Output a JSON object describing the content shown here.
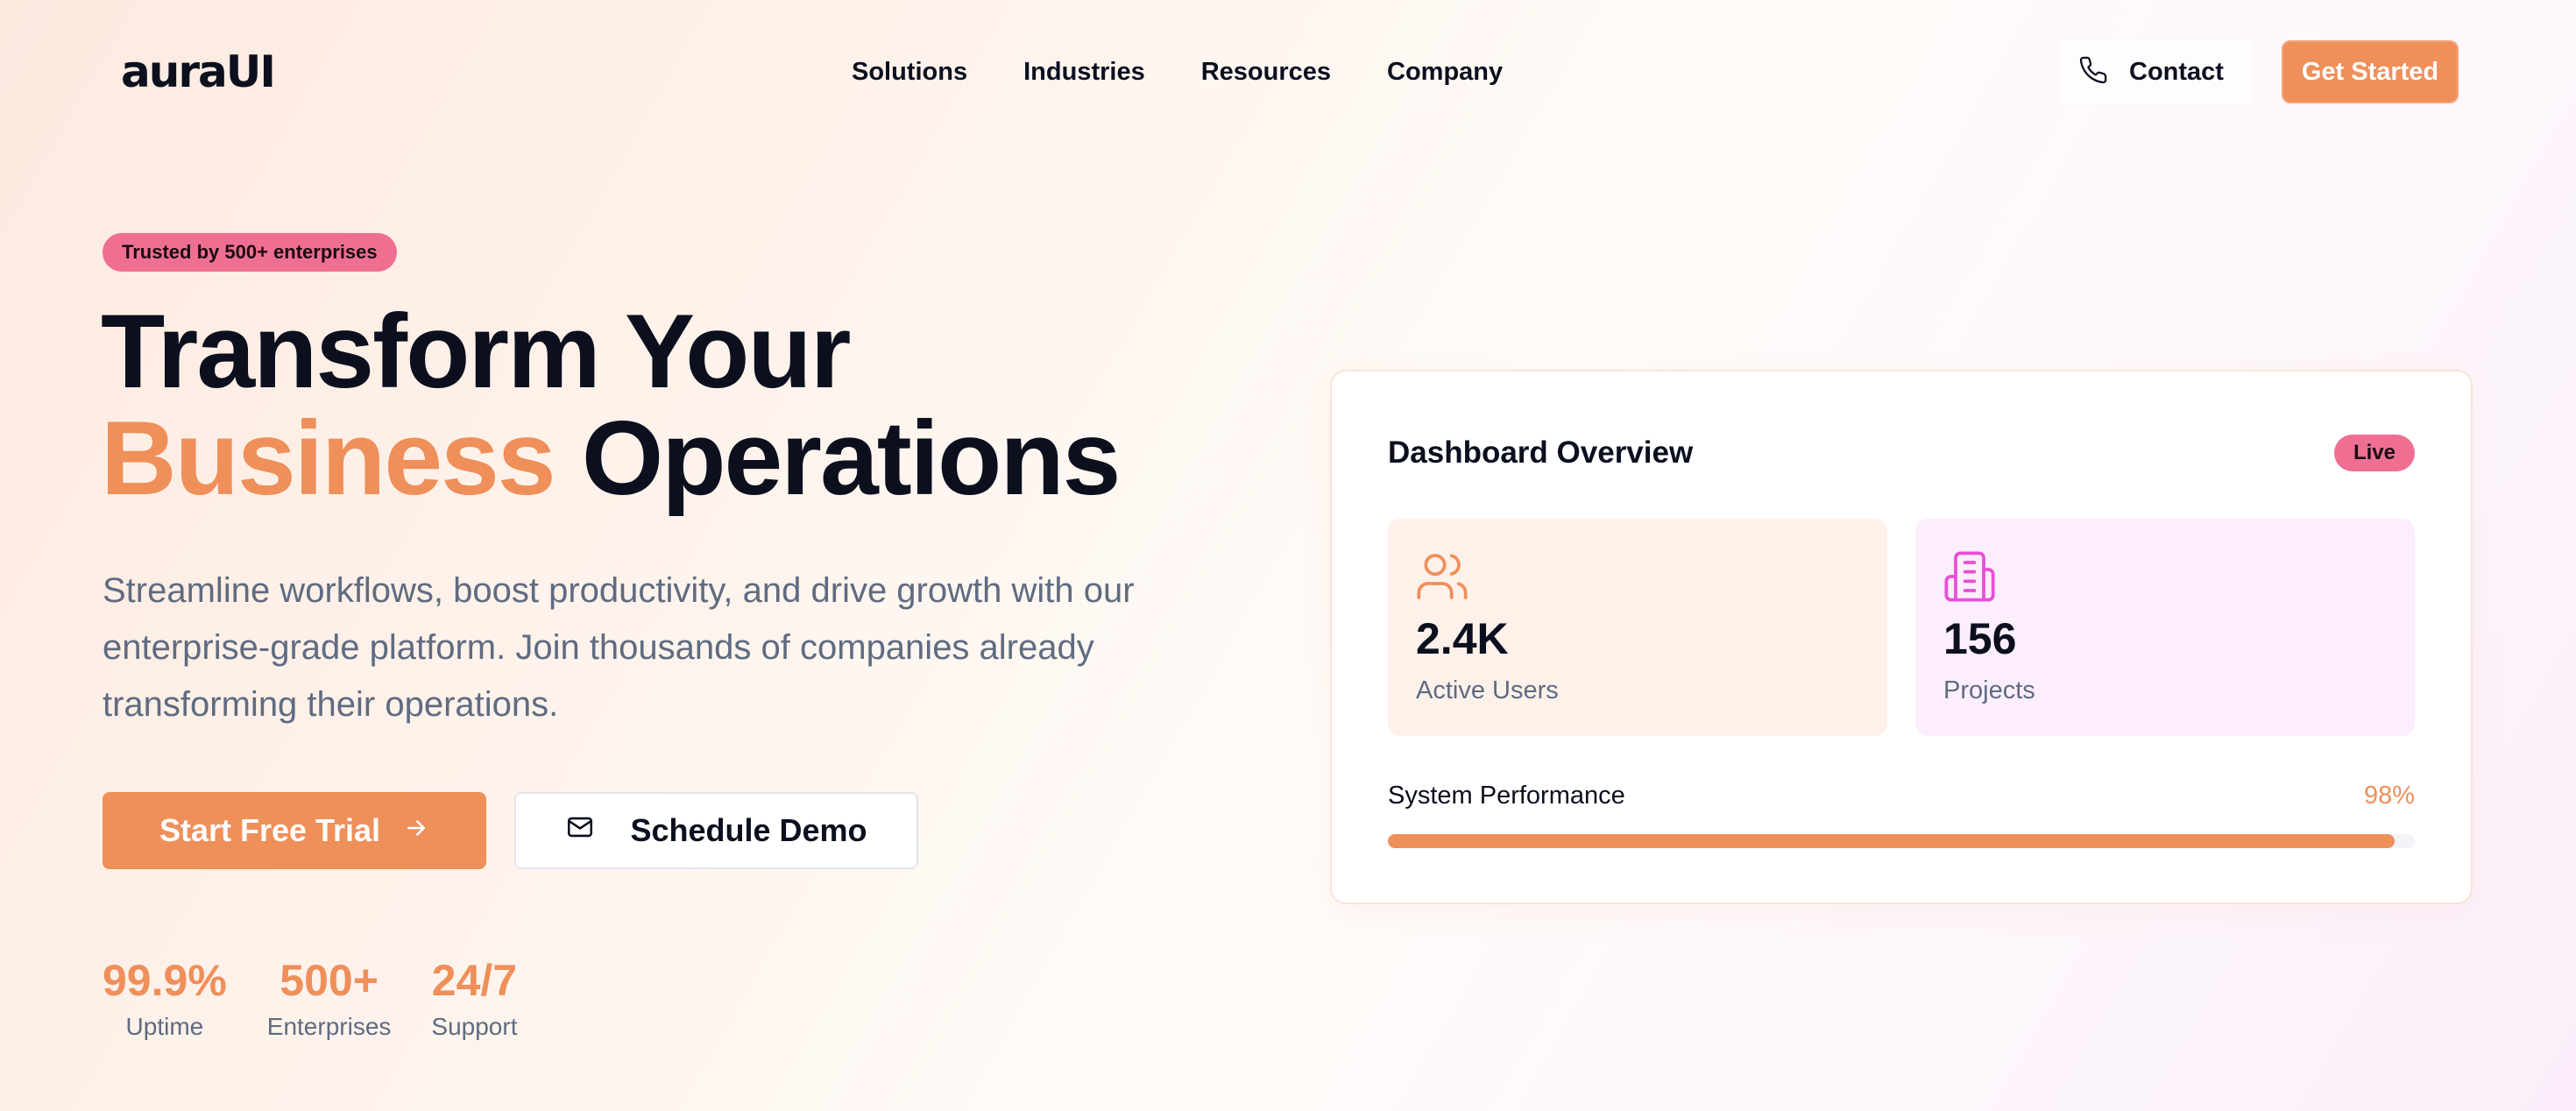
{
  "header": {
    "logo_text": "auraUI",
    "nav": [
      "Solutions",
      "Industries",
      "Resources",
      "Company"
    ],
    "contact_label": "Contact",
    "contact_icon": "phone-icon",
    "cta_label": "Get Started"
  },
  "hero": {
    "badge": "Trusted by 500+ enterprises",
    "title_line1": "Transform Your",
    "title_accent": "Business",
    "title_rest": "Operations",
    "description": "Streamline workflows, boost productivity, and drive growth with our enterprise-grade platform. Join thousands of companies already transforming their operations.",
    "primary_button": "Start Free Trial",
    "primary_icon": "arrow-right-icon",
    "secondary_button": "Schedule Demo",
    "secondary_icon": "mail-icon"
  },
  "stats": [
    {
      "value": "99.9%",
      "label": "Uptime"
    },
    {
      "value": "500+",
      "label": "Enterprises"
    },
    {
      "value": "24/7",
      "label": "Support"
    }
  ],
  "dashboard": {
    "title": "Dashboard Overview",
    "status": "Live",
    "metrics": [
      {
        "value": "2.4K",
        "label": "Active Users",
        "icon": "users-icon"
      },
      {
        "value": "156",
        "label": "Projects",
        "icon": "building-icon"
      }
    ],
    "performance_label": "System Performance",
    "performance_value": "98%",
    "performance_fraction": 0.98
  },
  "colors": {
    "accent": "#ef8f5a",
    "pink": "#ef6f92",
    "magenta_icon": "#e94ed6",
    "text_dark": "#0b0f1e",
    "text_muted": "#5f6b80"
  }
}
